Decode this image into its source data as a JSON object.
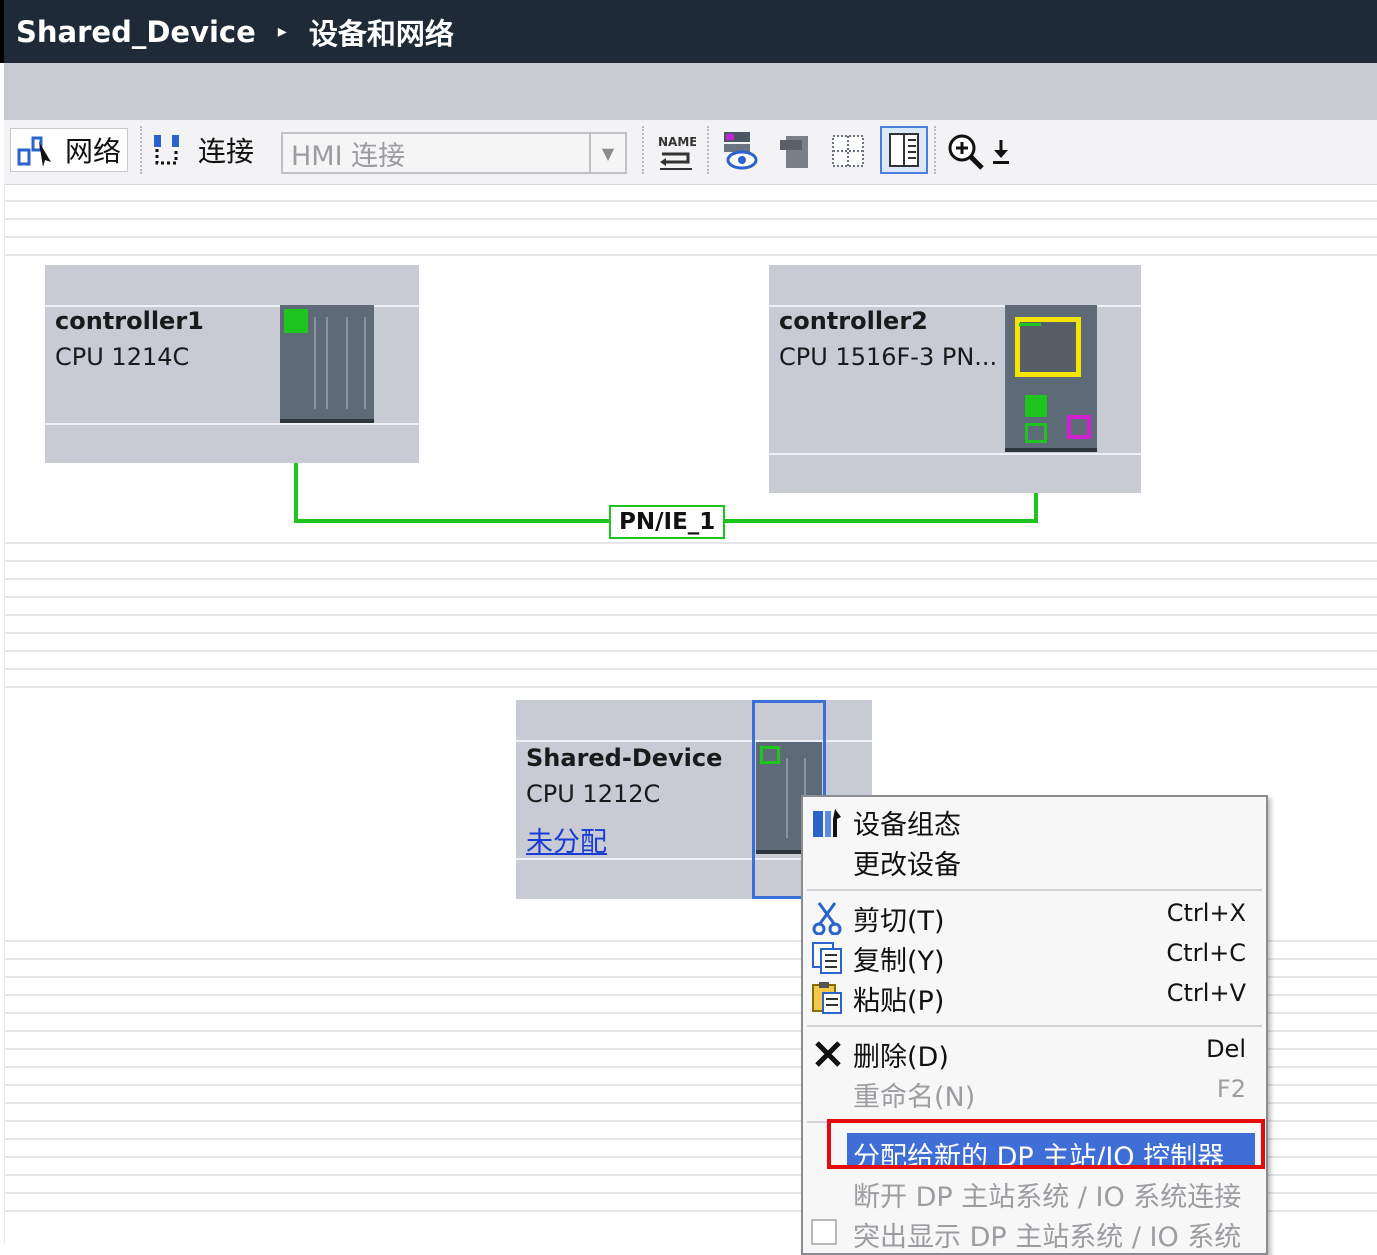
{
  "title": {
    "project": "Shared_Device",
    "separator": "▸",
    "page": "设备和网络"
  },
  "toolbar": {
    "network_label": "网络",
    "connections_label": "连接",
    "connection_type": "HMI 连接",
    "name_icon_text": "NAME"
  },
  "devices": [
    {
      "name": "controller1",
      "type": "CPU 1214C"
    },
    {
      "name": "controller2",
      "type": "CPU 1516F-3 PN..."
    },
    {
      "name": "Shared-Device",
      "type": "CPU 1212C",
      "link": "未分配"
    }
  ],
  "subnet": {
    "label": "PN/IE_1",
    "color": "#1ec51e"
  },
  "context_menu": {
    "items": [
      {
        "label": "设备组态",
        "shortcut": "",
        "enabled": true
      },
      {
        "label": "更改设备",
        "shortcut": "",
        "enabled": true
      },
      {
        "label": "剪切(T)",
        "shortcut": "Ctrl+X",
        "enabled": true
      },
      {
        "label": "复制(Y)",
        "shortcut": "Ctrl+C",
        "enabled": true
      },
      {
        "label": "粘贴(P)",
        "shortcut": "Ctrl+V",
        "enabled": true
      },
      {
        "label": "删除(D)",
        "shortcut": "Del",
        "enabled": true
      },
      {
        "label": "重命名(N)",
        "shortcut": "F2",
        "enabled": false
      },
      {
        "label": "分配给新的 DP 主站/IO 控制器",
        "shortcut": "",
        "enabled": true,
        "highlighted": true
      },
      {
        "label": "断开 DP 主站系统 / IO 系统连接",
        "shortcut": "",
        "enabled": false
      },
      {
        "label": "突出显示 DP 主站系统 / IO 系统",
        "shortcut": "",
        "enabled": false
      }
    ]
  },
  "colors": {
    "highlight": "#3f6fd6",
    "annotation": "#e30b0b",
    "status_green": "#1ec51e",
    "status_yellow": "#f5e400",
    "status_magenta": "#d11fd1"
  }
}
